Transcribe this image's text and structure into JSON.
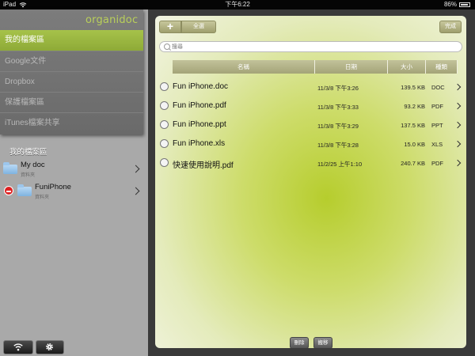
{
  "statusbar": {
    "device": "iPad",
    "time": "下午6:22",
    "battery": "86%",
    "battery_level": 0.86
  },
  "sidebar": {
    "logo": "organidoc",
    "menu": [
      {
        "label": "我的檔案區",
        "active": true
      },
      {
        "label": "Google文件",
        "active": false
      },
      {
        "label": "Dropbox",
        "active": false
      },
      {
        "label": "保護檔案區",
        "active": false
      },
      {
        "label": "iTunes檔案共享",
        "active": false
      }
    ],
    "section_title": "我的檔案區",
    "folders": [
      {
        "name": "My doc",
        "sub": "資料夾"
      },
      {
        "name": "FuniPhone",
        "sub": "資料夾"
      }
    ],
    "icons": {
      "wifi": "wifi-icon",
      "settings": "gear-icon"
    }
  },
  "toolbar": {
    "add_label": "+",
    "select_all_label": "全選",
    "done_label": "完成"
  },
  "search": {
    "placeholder": "搜尋"
  },
  "table": {
    "headers": {
      "name": "名稱",
      "date": "日期",
      "size": "大小",
      "type": "種類"
    },
    "rows": [
      {
        "name": "Fun iPhone.doc",
        "date": "11/3/8 下午3:26",
        "size": "139.5 KB",
        "type": "DOC"
      },
      {
        "name": "Fun iPhone.pdf",
        "date": "11/3/8 下午3:33",
        "size": "93.2 KB",
        "type": "PDF"
      },
      {
        "name": "Fun iPhone.ppt",
        "date": "11/3/8 下午3:29",
        "size": "137.5 KB",
        "type": "PPT"
      },
      {
        "name": "Fun iPhone.xls",
        "date": "11/3/8 下午3:28",
        "size": "15.0 KB",
        "type": "XLS"
      },
      {
        "name": "快速使用說明.pdf",
        "date": "11/2/25 上午1:10",
        "size": "240.7 KB",
        "type": "PDF"
      }
    ]
  },
  "actions": {
    "delete_label": "刪除",
    "move_label": "搬移"
  },
  "colors": {
    "accent_green": "#9bb63f",
    "panel_center": "#b6cd2d"
  }
}
